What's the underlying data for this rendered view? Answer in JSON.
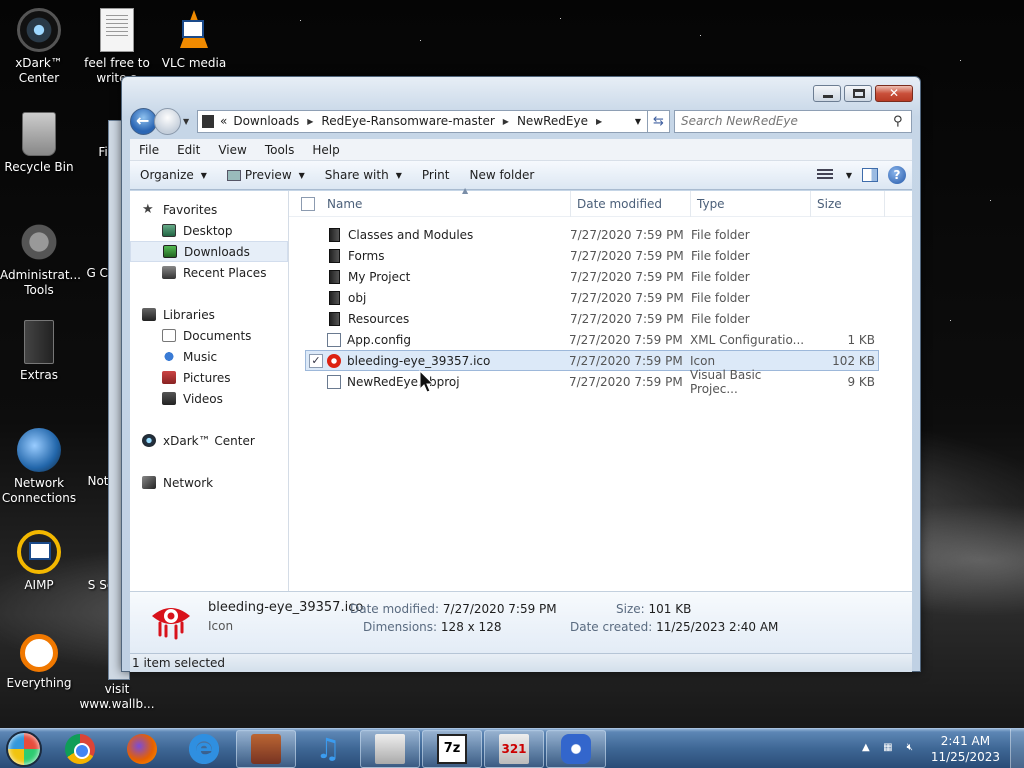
{
  "desktop": {
    "icons": [
      {
        "label": "xDark™ Center"
      },
      {
        "label": "feel free to write a"
      },
      {
        "label": "VLC media"
      },
      {
        "label": "Recycle Bin"
      },
      {
        "label": "Fi"
      },
      {
        "label": "Administrat... Tools"
      },
      {
        "label": "G Ch"
      },
      {
        "label": "Extras"
      },
      {
        "label": "Network Connections"
      },
      {
        "label": "Not"
      },
      {
        "label": "AIMP"
      },
      {
        "label": "S Se"
      },
      {
        "label": "Everything"
      },
      {
        "label": "visit www.wallb..."
      }
    ]
  },
  "window": {
    "address": {
      "overflow": "«",
      "crumbs": [
        "Downloads",
        "RedEye-Ransomware-master",
        "NewRedEye"
      ]
    },
    "search_placeholder": "Search NewRedEye",
    "menu": [
      "File",
      "Edit",
      "View",
      "Tools",
      "Help"
    ],
    "toolbar": {
      "organize": "Organize",
      "preview": "Preview",
      "share_with": "Share with",
      "print": "Print",
      "new_folder": "New folder"
    },
    "nav": {
      "favorites": "Favorites",
      "desktop": "Desktop",
      "downloads": "Downloads",
      "recent": "Recent Places",
      "libraries": "Libraries",
      "documents": "Documents",
      "music": "Music",
      "pictures": "Pictures",
      "videos": "Videos",
      "xdark": "xDark™ Center",
      "network": "Network"
    },
    "columns": {
      "name": "Name",
      "date": "Date modified",
      "type": "Type",
      "size": "Size"
    },
    "files": [
      {
        "name": "Classes and Modules",
        "date": "7/27/2020 7:59 PM",
        "type": "File folder",
        "size": ""
      },
      {
        "name": "Forms",
        "date": "7/27/2020 7:59 PM",
        "type": "File folder",
        "size": ""
      },
      {
        "name": "My Project",
        "date": "7/27/2020 7:59 PM",
        "type": "File folder",
        "size": ""
      },
      {
        "name": "obj",
        "date": "7/27/2020 7:59 PM",
        "type": "File folder",
        "size": ""
      },
      {
        "name": "Resources",
        "date": "7/27/2020 7:59 PM",
        "type": "File folder",
        "size": ""
      },
      {
        "name": "App.config",
        "date": "7/27/2020 7:59 PM",
        "type": "XML Configuratio...",
        "size": "1 KB"
      },
      {
        "name": "bleeding-eye_39357.ico",
        "date": "7/27/2020 7:59 PM",
        "type": "Icon",
        "size": "102 KB"
      },
      {
        "name": "NewRedEye.vbproj",
        "date": "7/27/2020 7:59 PM",
        "type": "Visual Basic Projec...",
        "size": "9 KB"
      }
    ],
    "details": {
      "name": "bleeding-eye_39357.ico",
      "kind": "Icon",
      "date_modified_label": "Date modified:",
      "date_modified": "7/27/2020 7:59 PM",
      "dimensions_label": "Dimensions:",
      "dimensions": "128 x 128",
      "size_label": "Size:",
      "size": "101 KB",
      "date_created_label": "Date created:",
      "date_created": "11/25/2023 2:40 AM"
    },
    "status": "1 item selected"
  },
  "taskbar": {
    "apps": [
      "Google Chrome",
      "Firefox",
      "Internet Explorer",
      "Archive",
      "iTunes",
      "Notepad",
      "7-Zip",
      "Media Player",
      "Infinity"
    ],
    "labels": {
      "seven_zip": "7z",
      "media321": "321",
      "ie": "e",
      "itunes": "♫"
    },
    "time": "2:41 AM",
    "date": "11/25/2023"
  },
  "colors": {
    "accent": "#3e6795",
    "selection": "#dce9f8",
    "window_frame": "#c0d1e4"
  }
}
